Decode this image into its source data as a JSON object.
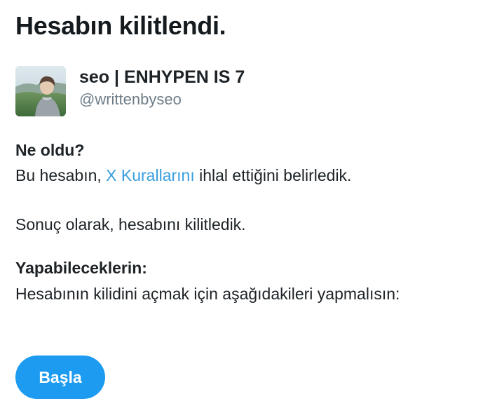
{
  "page": {
    "title": "Hesabın kilitlendi."
  },
  "account": {
    "display_name": "seo | ENHYPEN IS 7",
    "handle": "@writtenbyseo",
    "avatar_icon": "profile-photo"
  },
  "what_happened": {
    "heading": "Ne oldu?",
    "text_before_link": "Bu hesabın, ",
    "link_text": "X Kurallarını",
    "text_after_link": " ihlal ettiğini belirledik.",
    "result_text": "Sonuç olarak, hesabını kilitledik."
  },
  "what_you_can_do": {
    "heading": "Yapabileceklerin:",
    "text": "Hesabının kilidini açmak için aşağıdakileri yapmalısın:"
  },
  "actions": {
    "start_label": "Başla"
  },
  "colors": {
    "accent": "#1d9bf0",
    "link": "#3a9fde",
    "text": "#1c2226",
    "muted": "#6e7d88"
  }
}
